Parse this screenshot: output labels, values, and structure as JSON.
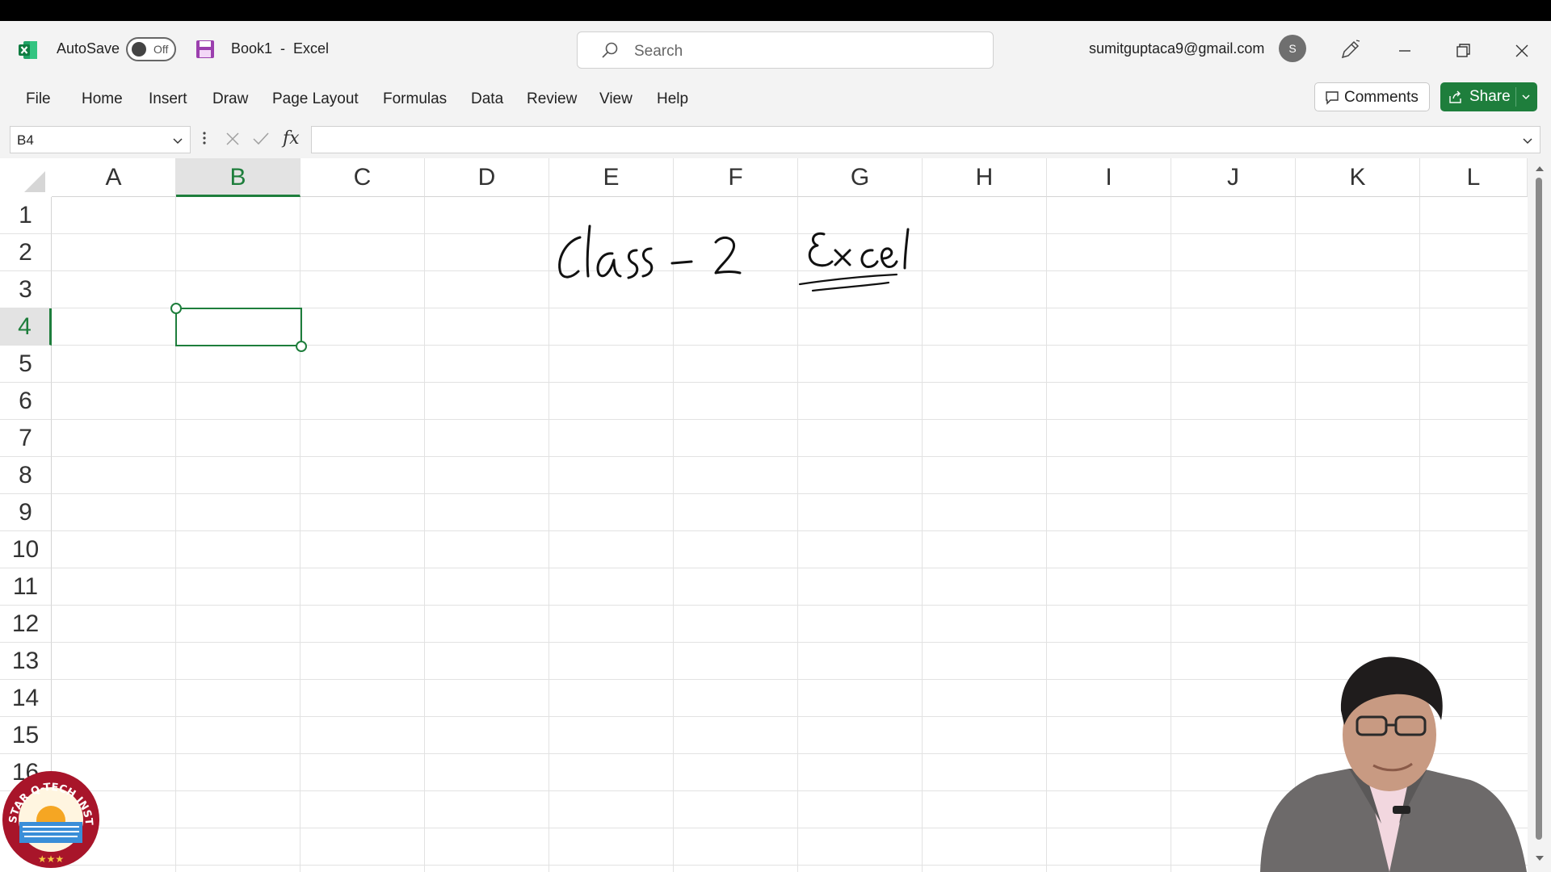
{
  "window": {
    "autosave_label": "AutoSave",
    "autosave_state": "Off",
    "document_title": "Book1  -  Excel",
    "search_placeholder": "Search",
    "account_email": "sumitguptaca9@gmail.com",
    "avatar_initial": "S"
  },
  "menu": {
    "items": [
      "File",
      "Home",
      "Insert",
      "Draw",
      "Page Layout",
      "Formulas",
      "Data",
      "Review",
      "View",
      "Help"
    ],
    "comments_label": "Comments",
    "share_label": "Share"
  },
  "formula_bar": {
    "name_box": "B4",
    "fx_label": "fx",
    "formula_value": ""
  },
  "sheet": {
    "columns": [
      "A",
      "B",
      "C",
      "D",
      "E",
      "F",
      "G",
      "H",
      "I",
      "J",
      "K",
      "L"
    ],
    "rows": [
      "1",
      "2",
      "3",
      "4",
      "5",
      "6",
      "7",
      "8",
      "9",
      "10",
      "11",
      "12",
      "13",
      "14",
      "15",
      "16"
    ],
    "selected_cell": "B4",
    "selected_column": "B",
    "selected_row": "4"
  },
  "annotation": {
    "handwritten_text": "Class - 2   Excel"
  },
  "watermark": {
    "logo_text": "STAR Q-TECH INSTITUTE"
  },
  "colors": {
    "accent_green": "#1e7e3c",
    "ribbon_bg": "#f3f3f3",
    "gridline": "#e2e2e2"
  }
}
